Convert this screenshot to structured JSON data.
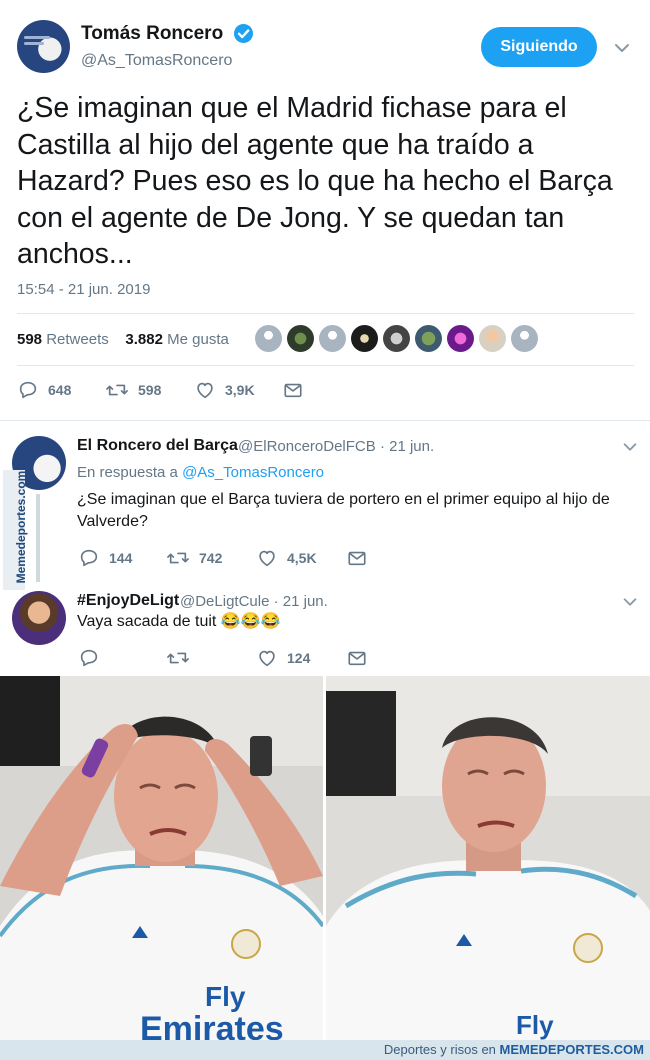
{
  "main_tweet": {
    "author_name": "Tomás Roncero",
    "author_handle": "@As_TomasRoncero",
    "follow_label": "Siguiendo",
    "text": "¿Se imaginan que el Madrid fichase para el Castilla al hijo del agente que ha traído a Hazard? Pues eso es lo que ha hecho el Barça con el agente de De Jong. Y se quedan tan anchos...",
    "timestamp": "15:54 - 21 jun. 2019",
    "retweets_count": "598",
    "retweets_label": "Retweets",
    "likes_count": "3.882",
    "likes_label": "Me gusta",
    "actions": {
      "replies": "648",
      "retweets": "598",
      "likes": "3,9K"
    }
  },
  "replies": [
    {
      "author_name": "El Roncero del Barça",
      "author_handle": "@ElRonceroDelFCB",
      "date": "· 21 jun.",
      "reply_to_label": "En respuesta a",
      "reply_to_handle": "@As_TomasRoncero",
      "text": "¿Se imaginan que el Barça tuviera de portero en el primer equipo al hijo de Valverde?",
      "actions": {
        "replies": "144",
        "retweets": "742",
        "likes": "4,5K"
      }
    },
    {
      "author_name": "#EnjoyDeLigt",
      "author_handle": "@DeLigtCule",
      "date": "· 21 jun.",
      "text": "Vaya sacada de tuit 😂😂😂",
      "actions": {
        "replies": "",
        "retweets": "",
        "likes": "124"
      }
    }
  ],
  "watermark_vertical": "Memedeportes.com",
  "footer": {
    "tagline": "Deportes y risos en",
    "brand": "MEMEDEPORTES.COM"
  },
  "photo_left": {
    "shirt_sponsor": "Emirates",
    "logo_text": "Fly"
  },
  "photo_right": {
    "logo_text": "Fly"
  },
  "colors": {
    "accent": "#1da1f2",
    "muted": "#657786",
    "text": "#14171a",
    "divider": "#e1e8ed"
  }
}
